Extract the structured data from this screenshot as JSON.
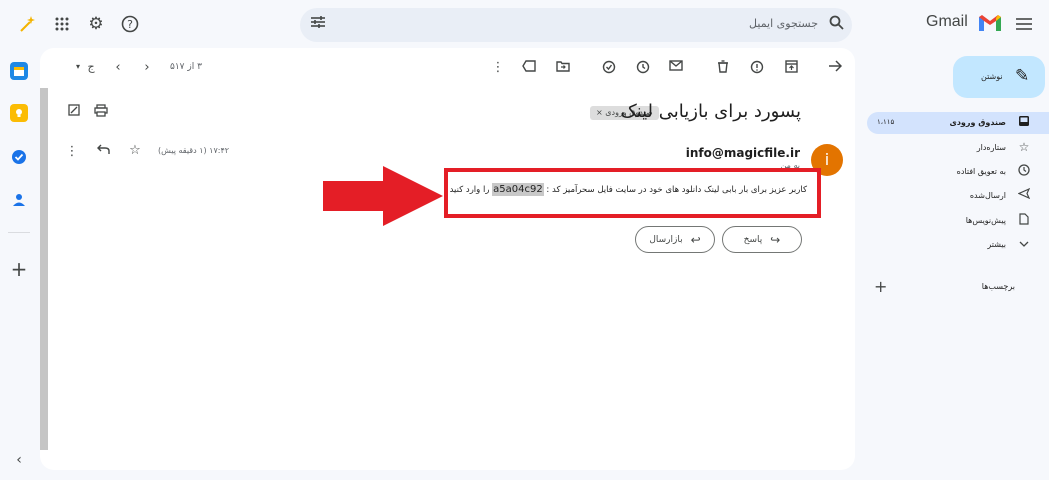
{
  "topbar": {
    "search_placeholder": "جستجوی ایمیل",
    "logo_text": "Gmail",
    "icons": [
      "magic-wand-icon",
      "apps-grid-icon",
      "settings-gear-icon",
      "help-icon",
      "search-icon",
      "filter-tune-icon",
      "hamburger-menu-icon"
    ]
  },
  "toolbar": {
    "pager_text": "۳ از ۵۱۷"
  },
  "email": {
    "subject": "پسورد برای بازیابی لینک",
    "label_chip": "صندوق ورودی ×",
    "avatar_letter": "i",
    "sender": "info@magicfile.ir",
    "to_me": "به من",
    "time": "۱۷:۴۲ (۱ دقیقه پیش)",
    "body_before": "کاربر عزیز برای بار بابی لینک دانلود های خود در سایت فایل سحرآمیز کد : ",
    "code": "a5a04c92",
    "body_after": " را وارد کنید",
    "reply_label": "پاسخ",
    "forward_label": "بازارسال"
  },
  "sidebar": {
    "compose_label": "نوشتن",
    "items": [
      {
        "label": "صندوق ورودی",
        "count": "۱،۱۱۵"
      },
      {
        "label": "ستاره‌دار",
        "count": ""
      },
      {
        "label": "به تعویق افتاده",
        "count": ""
      },
      {
        "label": "ارسال‌شده",
        "count": ""
      },
      {
        "label": "پیش‌نویس‌ها",
        "count": ""
      },
      {
        "label": "بیشتر",
        "count": ""
      }
    ],
    "labels_heading": "برچسب‌ها"
  },
  "colors": {
    "accent_red": "#e41e26",
    "compose_bg": "#c2e7ff",
    "active_nav_bg": "#d3e3fd",
    "avatar_bg": "#e37400"
  }
}
